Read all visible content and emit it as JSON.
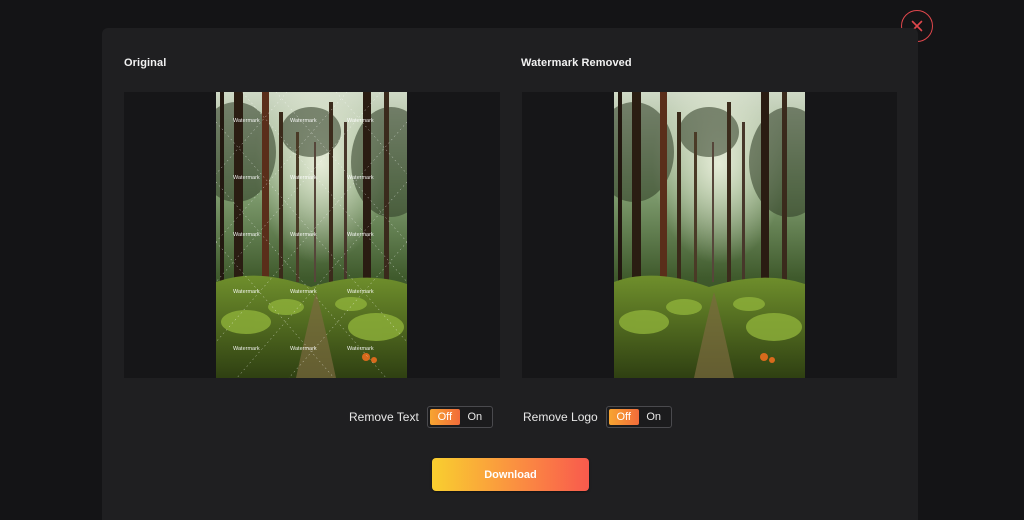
{
  "panes": {
    "original_title": "Original",
    "result_title": "Watermark Removed",
    "watermark_word": "Watermark"
  },
  "controls": {
    "remove_text": {
      "label": "Remove Text",
      "off_label": "Off",
      "on_label": "On",
      "selected": "Off"
    },
    "remove_logo": {
      "label": "Remove Logo",
      "off_label": "Off",
      "on_label": "On",
      "selected": "Off"
    }
  },
  "actions": {
    "download_label": "Download"
  },
  "icons": {
    "close": "close-icon"
  },
  "colors": {
    "accent_start": "#f7a531",
    "accent_end": "#f26b3a",
    "close_red": "#e0474c",
    "modal_bg": "#1f1f21"
  }
}
